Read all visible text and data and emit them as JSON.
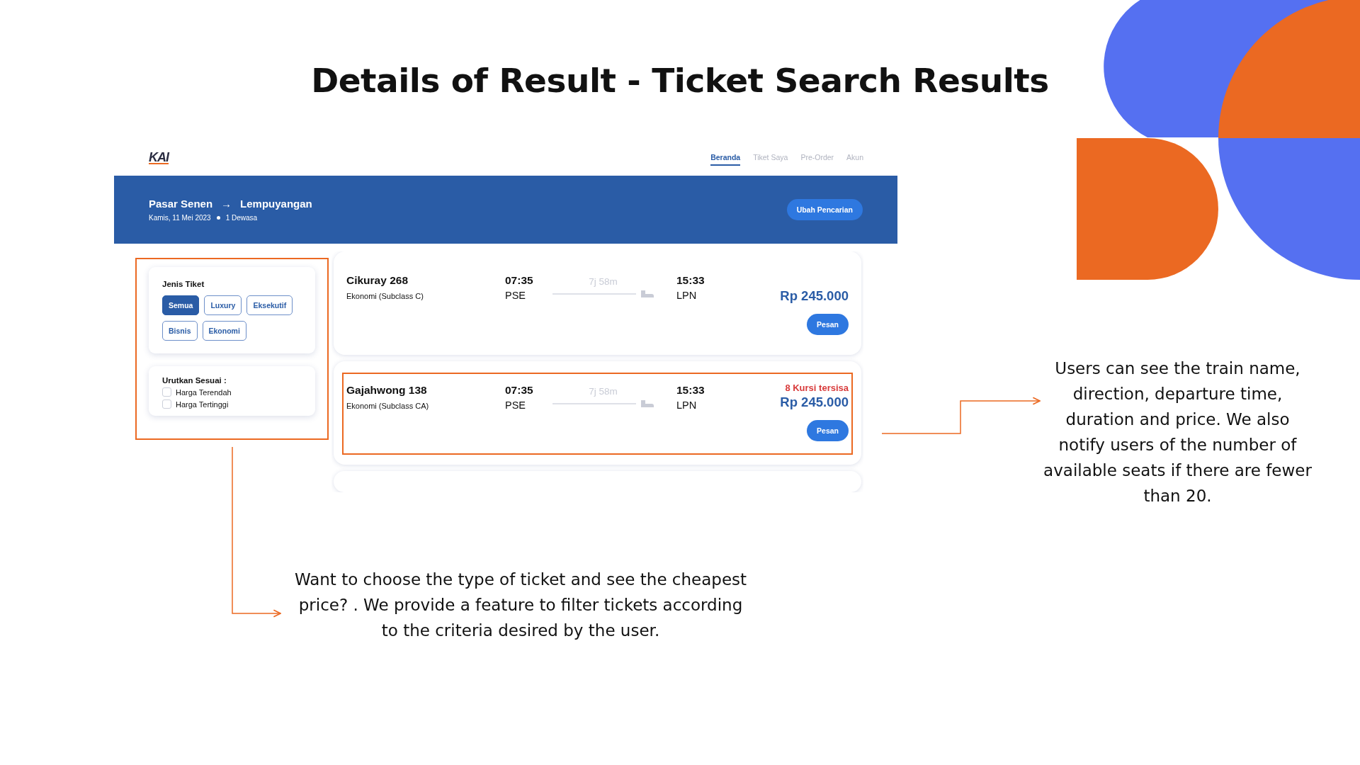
{
  "slide_title": "Details of Result - Ticket Search Results",
  "app": {
    "logo": "KAI",
    "nav": [
      {
        "label": "Beranda",
        "selected": true
      },
      {
        "label": "Tiket Saya",
        "selected": false
      },
      {
        "label": "Pre-Order",
        "selected": false
      },
      {
        "label": "Akun",
        "selected": false
      }
    ],
    "banner": {
      "origin": "Pasar Senen",
      "arrow": "→",
      "destination": "Lempuyangan",
      "date": "Kamis, 11 Mei 2023",
      "passengers": "1 Dewasa",
      "button": "Ubah Pencarian"
    },
    "filter": {
      "title": "Jenis Tiket",
      "chips": [
        {
          "label": "Semua",
          "selected": true
        },
        {
          "label": "Luxury",
          "selected": false
        },
        {
          "label": "Eksekutif",
          "selected": false
        },
        {
          "label": "Bisnis",
          "selected": false
        },
        {
          "label": "Ekonomi",
          "selected": false
        }
      ],
      "sort_title": "Urutkan Sesuai :",
      "sort_options": [
        {
          "label": "Harga Terendah",
          "checked": false
        },
        {
          "label": "Harga Tertinggi",
          "checked": false
        }
      ],
      "highlighted": true
    },
    "results": [
      {
        "name": "Cikuray 268",
        "class": "Ekonomi (Subclass C)",
        "depart_time": "07:35",
        "depart_station": "PSE",
        "duration": "7j 58m",
        "arrive_time": "15:33",
        "arrive_station": "LPN",
        "price": "Rp 245.000",
        "button": "Pesan",
        "highlighted": false
      },
      {
        "name": "Gajahwong 138",
        "class": "Ekonomi (Subclass CA)",
        "depart_time": "07:35",
        "depart_station": "PSE",
        "duration": "7j 58m",
        "arrive_time": "15:33",
        "arrive_station": "LPN",
        "seats_left": "8 Kursi tersisa",
        "price": "Rp 245.000",
        "button": "Pesan",
        "highlighted": true
      }
    ]
  },
  "annotations": [
    {
      "text": "Users can see the train name, direction, departure time, duration and price. We also notify users of the number of available seats if there are fewer than 20."
    },
    {
      "text": "Want to choose the type of ticket and see the cheapest price? . We provide a feature to filter tickets according to the criteria desired by the user."
    }
  ]
}
